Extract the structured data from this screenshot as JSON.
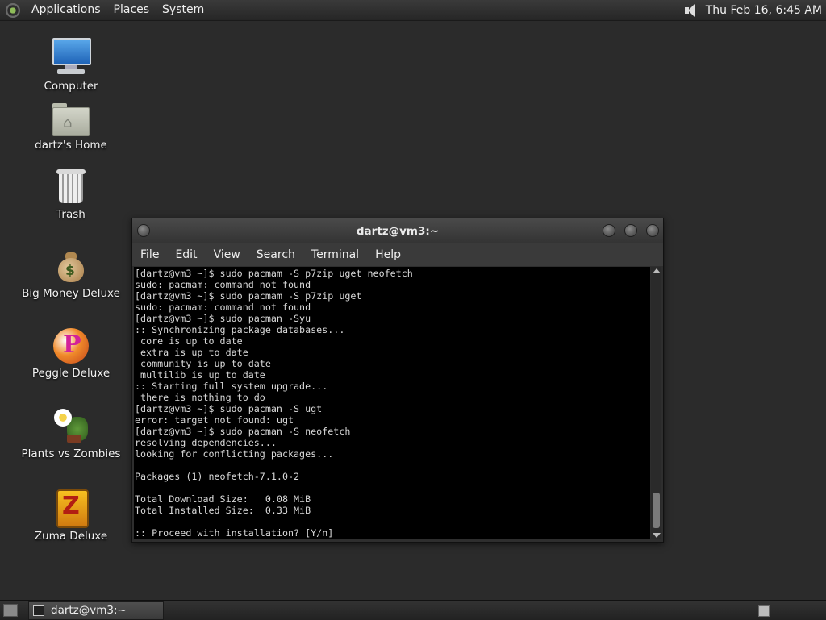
{
  "top_panel": {
    "menus": [
      "Applications",
      "Places",
      "System"
    ],
    "clock": "Thu Feb 16,  6:45 AM"
  },
  "desktop_icons": {
    "computer": "Computer",
    "home": "dartz's Home",
    "trash": "Trash",
    "big_money": "Big Money Deluxe",
    "peggle": "Peggle Deluxe",
    "plants": "Plants vs Zombies",
    "zuma": "Zuma Deluxe"
  },
  "terminal_window": {
    "title": "dartz@vm3:~",
    "menu": [
      "File",
      "Edit",
      "View",
      "Search",
      "Terminal",
      "Help"
    ],
    "lines": [
      "[dartz@vm3 ~]$ sudo pacmam -S p7zip uget neofetch",
      "sudo: pacmam: command not found",
      "[dartz@vm3 ~]$ sudo pacmam -S p7zip uget",
      "sudo: pacmam: command not found",
      "[dartz@vm3 ~]$ sudo pacman -Syu",
      ":: Synchronizing package databases...",
      " core is up to date",
      " extra is up to date",
      " community is up to date",
      " multilib is up to date",
      ":: Starting full system upgrade...",
      " there is nothing to do",
      "[dartz@vm3 ~]$ sudo pacman -S ugt",
      "error: target not found: ugt",
      "[dartz@vm3 ~]$ sudo pacman -S neofetch",
      "resolving dependencies...",
      "looking for conflicting packages...",
      "",
      "Packages (1) neofetch-7.1.0-2",
      "",
      "Total Download Size:   0.08 MiB",
      "Total Installed Size:  0.33 MiB",
      "",
      ":: Proceed with installation? [Y/n]"
    ]
  },
  "taskbar": {
    "task_label": "dartz@vm3:~"
  }
}
